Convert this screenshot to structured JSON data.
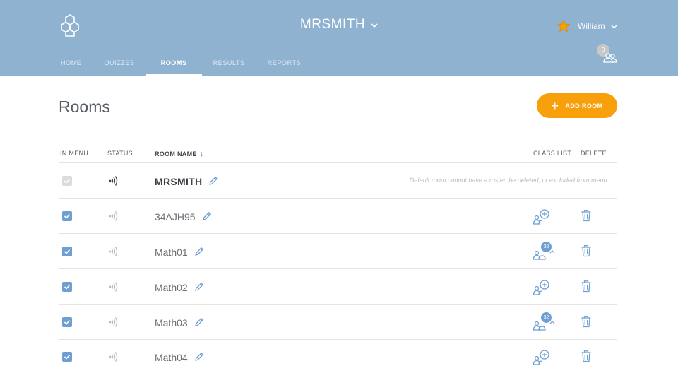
{
  "header": {
    "room_name": "MRSMITH",
    "user_name": "William",
    "student_count": "0",
    "nav": [
      {
        "label": "HOME"
      },
      {
        "label": "QUIZZES"
      },
      {
        "label": "ROOMS"
      },
      {
        "label": "RESULTS"
      },
      {
        "label": "REPORTS"
      }
    ],
    "active_tab": "ROOMS",
    "colors": {
      "header_bg": "#8fb2d1",
      "accent": "#f7a00c",
      "link_blue": "#6d9fd3"
    }
  },
  "main": {
    "title": "Rooms",
    "add_button": "ADD ROOM",
    "columns": {
      "in_menu": "IN MENU",
      "status": "STATUS",
      "room_name": "ROOM NAME",
      "class_list": "CLASS LIST",
      "delete": "DELETE"
    },
    "sort_column": "ROOM NAME",
    "sort_direction": "descending",
    "default_note": "Default room cannot have a roster, be deleted, or excluded from menu.",
    "rows": [
      {
        "name": "MRSMITH",
        "in_menu": true,
        "in_menu_disabled": true,
        "status": "active",
        "default": true
      },
      {
        "name": "34AJH95",
        "in_menu": true,
        "status": "inactive",
        "roster_count": null
      },
      {
        "name": "Math01",
        "in_menu": true,
        "status": "inactive",
        "roster_count": "32"
      },
      {
        "name": "Math02",
        "in_menu": true,
        "status": "inactive",
        "roster_count": null
      },
      {
        "name": "Math03",
        "in_menu": true,
        "status": "inactive",
        "roster_count": "32"
      },
      {
        "name": "Math04",
        "in_menu": true,
        "status": "inactive",
        "roster_count": null
      }
    ]
  }
}
